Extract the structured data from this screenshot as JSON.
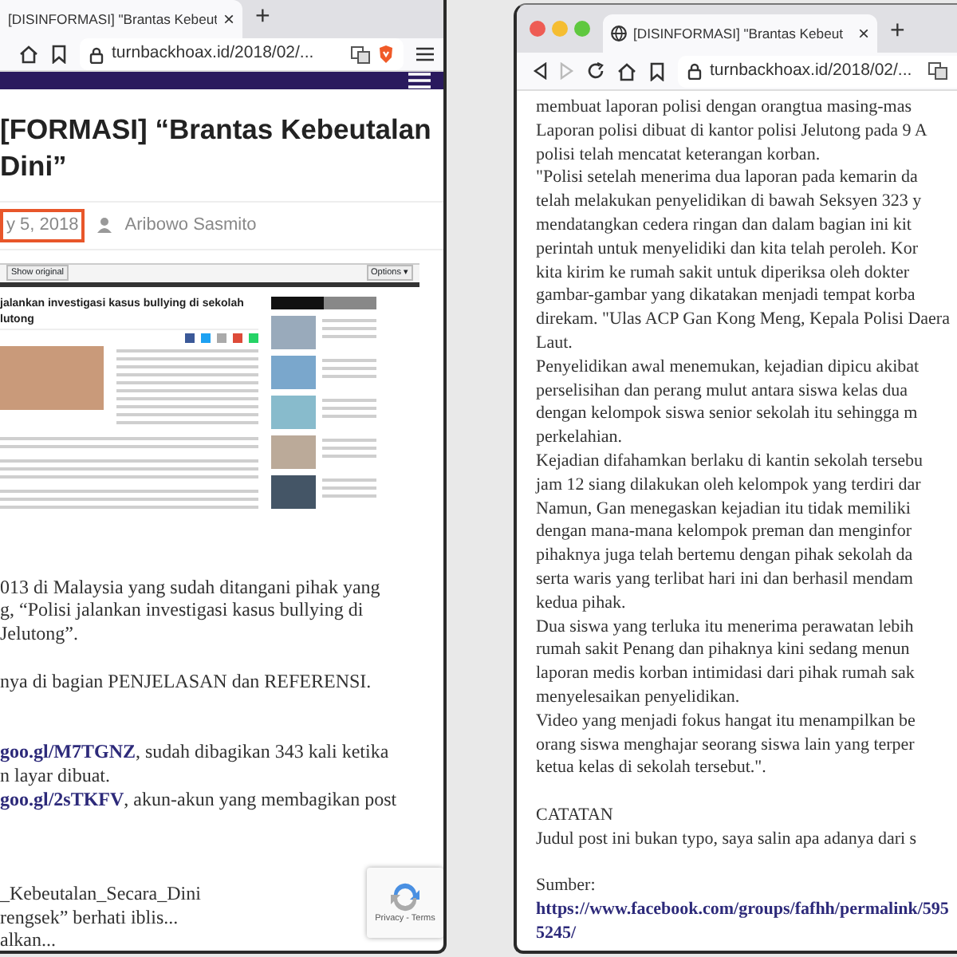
{
  "left_window": {
    "tab": {
      "title": "[DISINFORMASI] \"Brantas Kebeut",
      "close": "×"
    },
    "new_tab": "+",
    "address": "turnbackhoax.id/2018/02/...",
    "article": {
      "title_lines": [
        "[FORMASI] “Brantas Kebeutalan",
        "Dini”"
      ],
      "date": "y 5, 2018",
      "author": "Aribowo Sasmito",
      "embedded_screenshot": {
        "toolbar_button": "Show original",
        "options": "Options ▾",
        "headline_lines": [
          "jalankan investigasi kasus bullying di sekolah",
          "lutong"
        ]
      },
      "body_lines": [
        {
          "kind": "text",
          "text": "013 di Malaysia yang sudah ditangani pihak yang"
        },
        {
          "kind": "text",
          "text": "g, “Polisi jalankan investigasi kasus bullying di"
        },
        {
          "kind": "text",
          "text": "Jelutong”."
        },
        {
          "kind": "gap"
        },
        {
          "kind": "text",
          "text": "nya di bagian PENJELASAN dan REFERENSI."
        },
        {
          "kind": "gap"
        },
        {
          "kind": "gap"
        },
        {
          "kind": "mixed",
          "link": "goo.gl/M7TGNZ",
          "text": ", sudah dibagikan 343 kali ketika"
        },
        {
          "kind": "text",
          "text": "n layar dibuat."
        },
        {
          "kind": "mixed",
          "link": "goo.gl/2sTKFV",
          "text": ", akun-akun yang membagikan post"
        },
        {
          "kind": "gap"
        },
        {
          "kind": "gap"
        },
        {
          "kind": "gap"
        },
        {
          "kind": "text",
          "text": "_Kebeutalan_Secara_Dini"
        },
        {
          "kind": "text",
          "text": "rengsek” berhati iblis..."
        },
        {
          "kind": "text",
          "text": "alkan..."
        }
      ]
    },
    "recaptcha": {
      "links": "Privacy - Terms"
    }
  },
  "right_window": {
    "tab": {
      "title": "[DISINFORMASI] \"Brantas Kebeut",
      "close": "×"
    },
    "new_tab": "+",
    "address": "turnbackhoax.id/2018/02/...",
    "body_lines": [
      {
        "kind": "text",
        "text": "membuat laporan polisi dengan orangtua masing-mas"
      },
      {
        "kind": "text",
        "text": "Laporan polisi dibuat di kantor polisi Jelutong pada 9 A"
      },
      {
        "kind": "text",
        "text": "polisi telah mencatat keterangan korban."
      },
      {
        "kind": "text",
        "text": "\"Polisi setelah menerima dua laporan pada kemarin da"
      },
      {
        "kind": "text",
        "text": "telah melakukan penyelidikan di bawah Seksyen 323 y"
      },
      {
        "kind": "text",
        "text": "mendatangkan cedera ringan dan dalam bagian ini kit"
      },
      {
        "kind": "text",
        "text": "perintah untuk menyelidiki dan kita telah peroleh. Kor"
      },
      {
        "kind": "text",
        "text": "kita kirim ke rumah sakit untuk diperiksa oleh dokter"
      },
      {
        "kind": "text",
        "text": "gambar-gambar yang dikatakan menjadi tempat korba"
      },
      {
        "kind": "text",
        "text": "direkam. \"Ulas ACP Gan Kong Meng, Kepala Polisi Daera"
      },
      {
        "kind": "text",
        "text": "Laut."
      },
      {
        "kind": "text",
        "text": "Penyelidikan awal menemukan, kejadian dipicu akibat"
      },
      {
        "kind": "text",
        "text": "perselisihan dan perang mulut antara siswa kelas dua"
      },
      {
        "kind": "text",
        "text": "dengan kelompok siswa senior sekolah itu sehingga m"
      },
      {
        "kind": "text",
        "text": "perkelahian."
      },
      {
        "kind": "text",
        "text": "Kejadian difahamkan berlaku di kantin sekolah tersebu"
      },
      {
        "kind": "text",
        "text": "jam 12 siang dilakukan oleh kelompok yang terdiri dar"
      },
      {
        "kind": "text",
        "text": "Namun, Gan menegaskan kejadian itu tidak memiliki"
      },
      {
        "kind": "text",
        "text": "dengan mana-mana kelompok preman dan menginfor"
      },
      {
        "kind": "text",
        "text": "pihaknya juga telah bertemu dengan pihak sekolah da"
      },
      {
        "kind": "text",
        "text": "serta waris yang terlibat hari ini dan berhasil mendam"
      },
      {
        "kind": "text",
        "text": "kedua pihak."
      },
      {
        "kind": "text",
        "text": "Dua siswa yang terluka itu menerima perawatan lebih"
      },
      {
        "kind": "text",
        "text": "rumah sakit Penang dan pihaknya kini sedang menun"
      },
      {
        "kind": "text",
        "text": "laporan medis korban intimidasi dari pihak rumah sak"
      },
      {
        "kind": "text",
        "text": "menyelesaikan penyelidikan."
      },
      {
        "kind": "text",
        "text": "Video yang menjadi fokus hangat itu menampilkan be"
      },
      {
        "kind": "text",
        "text": "orang siswa menghajar seorang siswa lain yang terper"
      },
      {
        "kind": "text",
        "text": "ketua kelas di sekolah tersebut.\"."
      },
      {
        "kind": "gap"
      },
      {
        "kind": "text",
        "text": "CATATAN"
      },
      {
        "kind": "text",
        "text": "Judul post ini bukan typo, saya salin apa adanya dari s"
      },
      {
        "kind": "gap"
      },
      {
        "kind": "text",
        "text": "Sumber:"
      },
      {
        "kind": "link",
        "text": "https://www.facebook.com/groups/fafhh/permalink/595"
      },
      {
        "kind": "link",
        "text": "5245/"
      }
    ]
  }
}
